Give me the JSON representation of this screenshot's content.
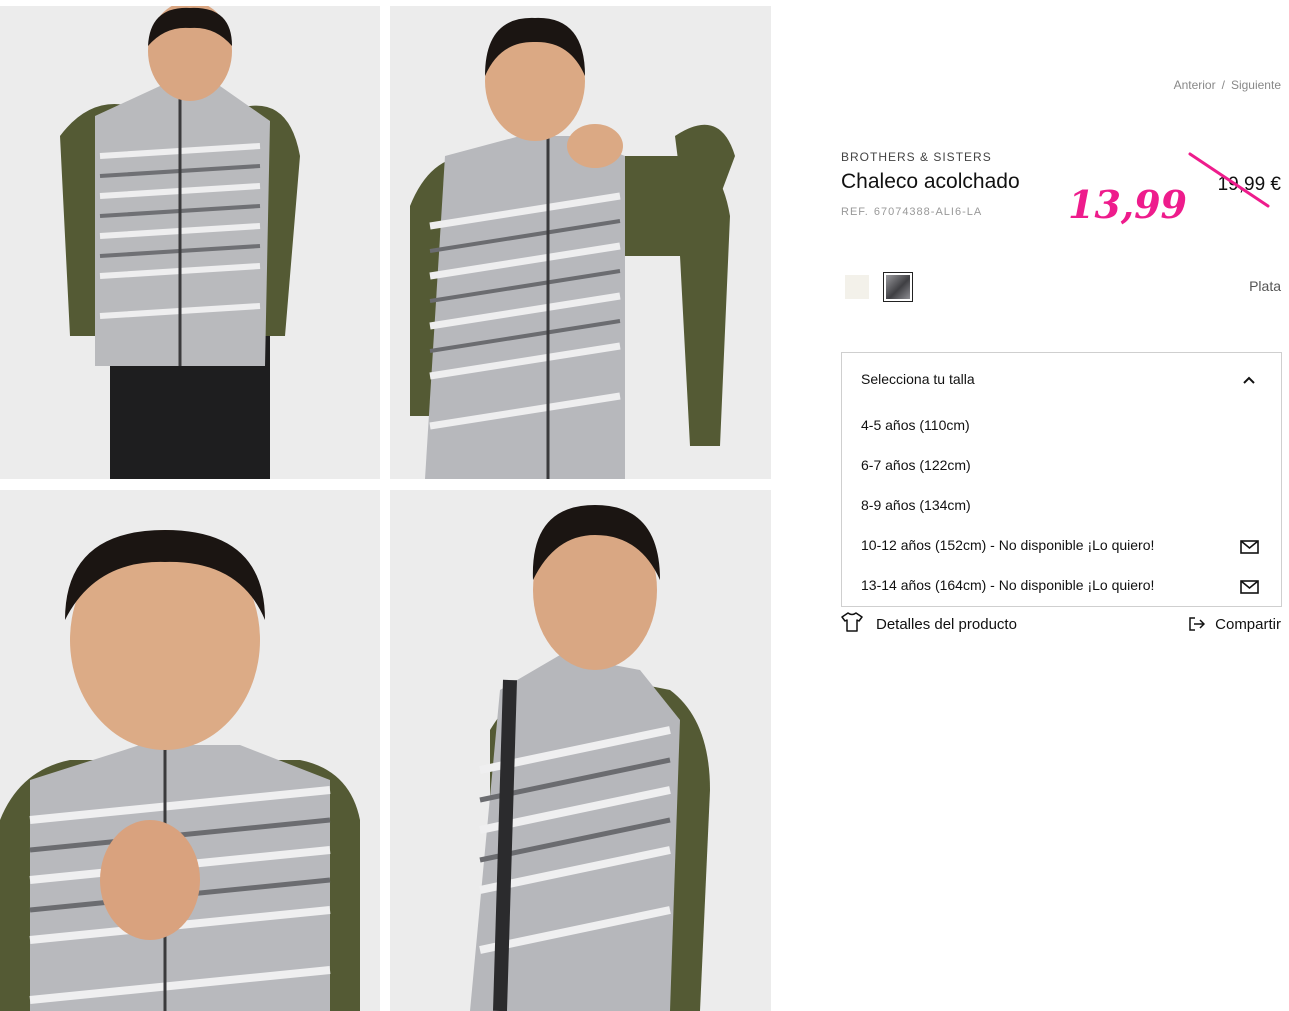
{
  "navigation": {
    "previous": "Anterior",
    "separator": "/",
    "next": "Siguiente"
  },
  "product": {
    "brand": "BROTHERS & SISTERS",
    "title": "Chaleco acolchado",
    "ref_label": "REF.",
    "ref_value": "67074388-ALI6-LA",
    "original_price": "19,99 €",
    "sale_price": "13,99"
  },
  "colors": {
    "swatches": [
      {
        "name": "cream",
        "hex": "#f3f1ea"
      },
      {
        "name": "silver",
        "hex": "#6e6e72"
      }
    ],
    "selected_name": "Plata"
  },
  "sizes": {
    "header": "Selecciona tu talla",
    "options": [
      {
        "label": "4-5 años (110cm)",
        "notify": false
      },
      {
        "label": "6-7 años (122cm)",
        "notify": false
      },
      {
        "label": "8-9 años (134cm)",
        "notify": false
      },
      {
        "label": "10-12 años (152cm) - No disponible ¡Lo quiero!",
        "notify": true
      },
      {
        "label": "13-14 años (164cm) - No disponible ¡Lo quiero!",
        "notify": true
      }
    ]
  },
  "actions": {
    "details": "Detalles del producto",
    "share": "Compartir"
  },
  "theme": {
    "sale_color": "#ee1c8c",
    "jacket": "#5a5e36",
    "vest": "#b5b6ba"
  }
}
